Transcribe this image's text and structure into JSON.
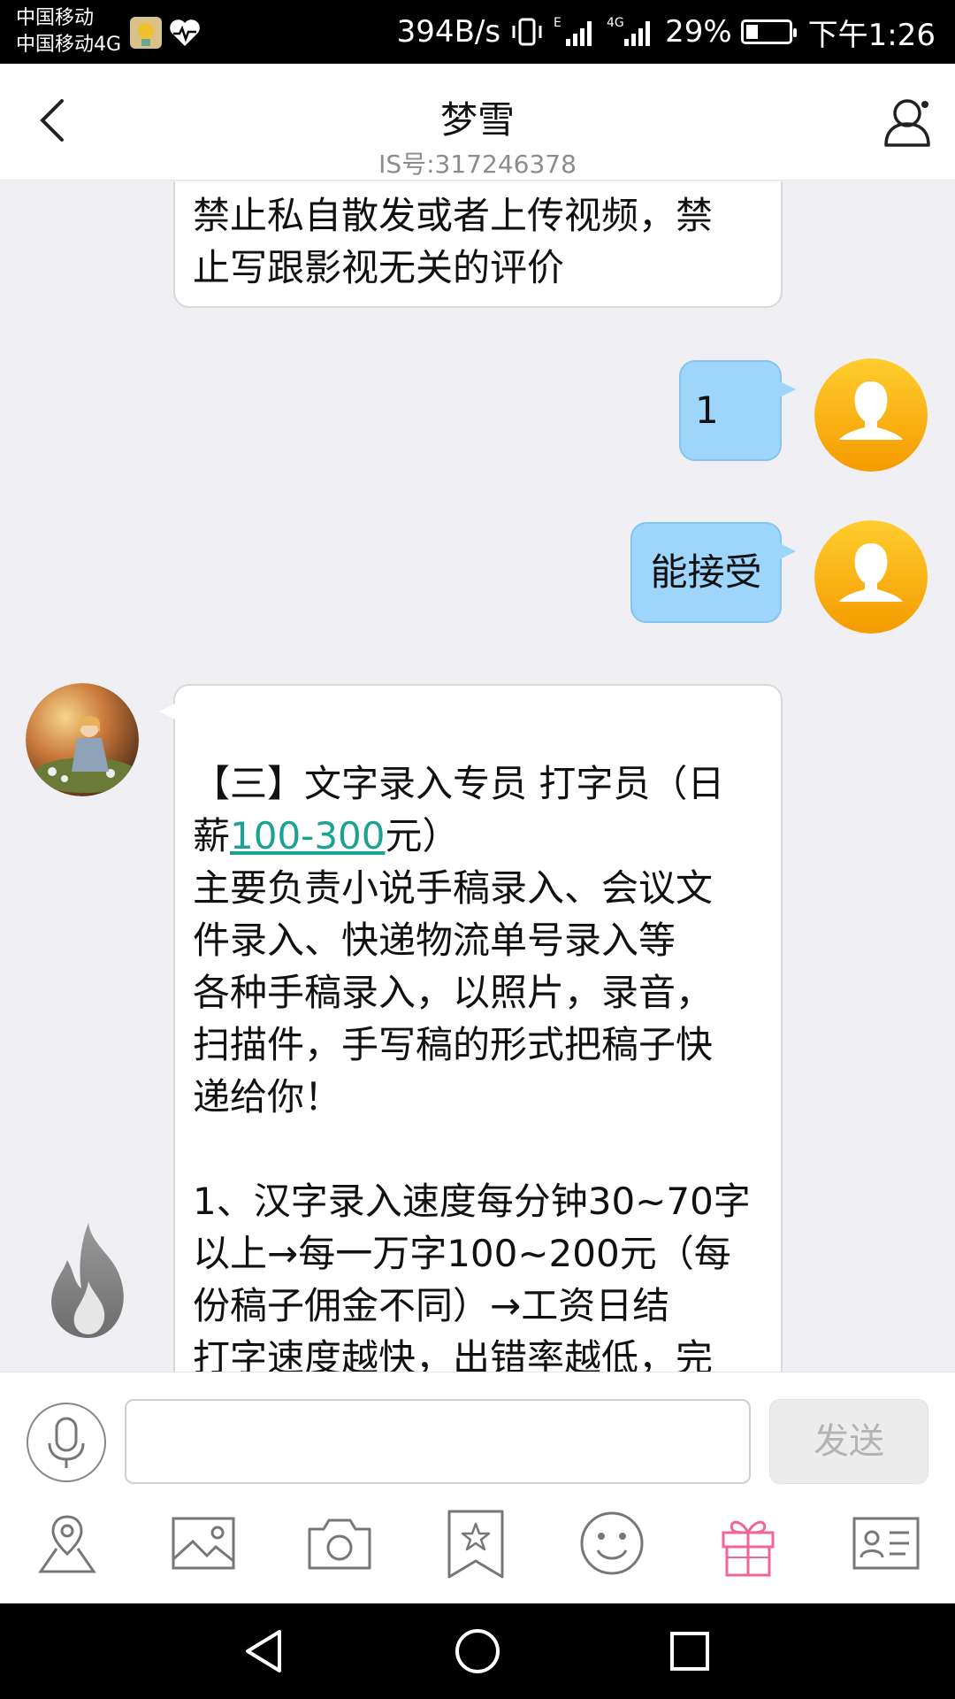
{
  "status_bar": {
    "carrier_1": "中国移动",
    "carrier_2": "中国移动4G",
    "network_speed": "394B/s",
    "signal_1": "E",
    "signal_2": "4G",
    "battery_percent": "29%",
    "battery_level": 0.29,
    "time": "下午1:26"
  },
  "header": {
    "title": "梦雪",
    "subtitle": "IS号:317246378"
  },
  "messages": {
    "m0": {
      "direction": "incoming",
      "lines": [
        "禁止私自散发或者上传视频，禁",
        "止写跟影视无关的评价"
      ]
    },
    "m1": {
      "direction": "outgoing",
      "text": "1"
    },
    "m2": {
      "direction": "outgoing",
      "text": "能接受"
    },
    "m3": {
      "direction": "incoming",
      "line1": "【三】文字录入专员 打字员（日",
      "line2_pre": "薪",
      "line2_link": "100-300",
      "line2_post": "元）",
      "body_lines": [
        "主要负责小说手稿录入、会议文",
        "件录入、快递物流单号录入等",
        "各种手稿录入，以照片，录音，",
        "扫描件，手写稿的形式把稿子快",
        "递给你！",
        "",
        "1、汉字录入速度每分钟30~70字",
        "以上→每一万字100~200元（每",
        "份稿子佣金不同）→工资日结",
        "打字速度越快，出错率越低，完"
      ]
    }
  },
  "input_bar": {
    "placeholder": "",
    "send_label": "发送"
  },
  "toolbar": {
    "items": [
      "location-icon",
      "image-icon",
      "camera-icon",
      "favorite-icon",
      "emoji-icon",
      "gift-icon",
      "contact-card-icon"
    ],
    "accent": "#f0649a"
  },
  "colors": {
    "outgoing_bubble": "#9dd5fb",
    "link": "#1aa391",
    "avatar_me": "#f5a300"
  }
}
